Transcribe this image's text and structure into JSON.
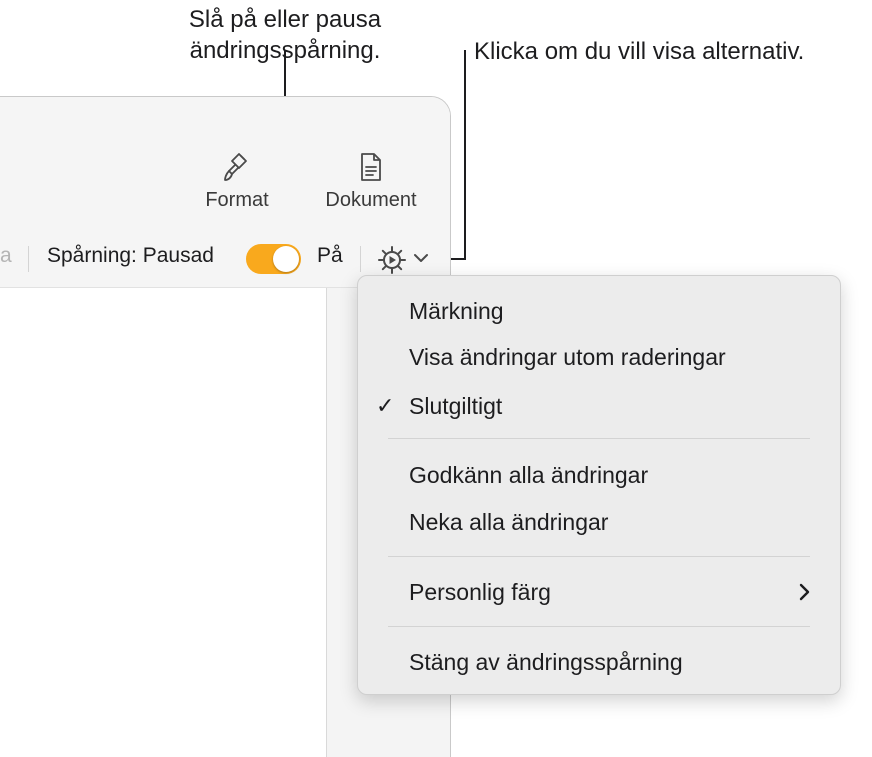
{
  "callouts": {
    "toggle_line1": "Slå på eller pausa",
    "toggle_line2": "ändringsspårning.",
    "options": "Klicka om du vill visa alternativ."
  },
  "toolbar": {
    "format_label": "Format",
    "format_icon": "paintbrush-icon",
    "dokument_label": "Dokument",
    "dokument_icon": "document-icon"
  },
  "tracking_bar": {
    "cut_text": "a",
    "status_label": "Spårning: Pausad",
    "toggle_on": true,
    "on_label": "På",
    "toggle_color": "#f9a91d",
    "options_icon": "gear-icon"
  },
  "menu": {
    "items": [
      {
        "label": "Märkning",
        "checked": false
      },
      {
        "label": "Visa ändringar utom raderingar",
        "checked": false
      },
      {
        "label": "Slutgiltigt",
        "checked": true,
        "check": "✓"
      },
      {
        "label": "Godkänn alla ändringar"
      },
      {
        "label": "Neka alla ändringar"
      },
      {
        "label": "Personlig färg",
        "has_submenu": true
      },
      {
        "label": "Stäng av ändringsspårning"
      }
    ]
  }
}
